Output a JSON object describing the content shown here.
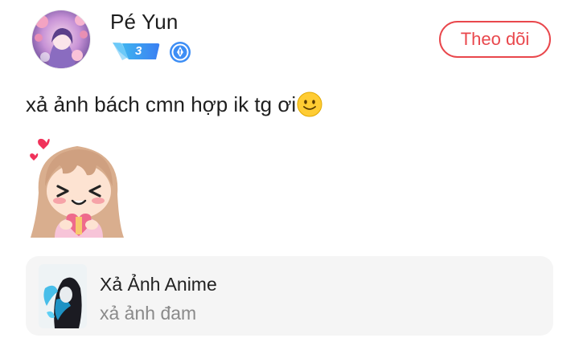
{
  "author": {
    "name": "Pé Yun",
    "level": "3",
    "avatar_icon": "anime-girl-avatar",
    "role_icon": "pen-nib-badge-icon"
  },
  "follow_button": {
    "label": "Theo dõi",
    "color": "#e9474c"
  },
  "post": {
    "text": "xả ảnh bách cmn hợp ik tg ơi",
    "emoji_icon": "slightly-smiling-face-icon",
    "sticker_icon": "happy-anime-girl-holding-heart-sticker"
  },
  "topic_card": {
    "title": "Xả Ảnh Anime",
    "subtitle": "xả ảnh đam",
    "thumbnail_icon": "anime-character-thumbnail"
  }
}
